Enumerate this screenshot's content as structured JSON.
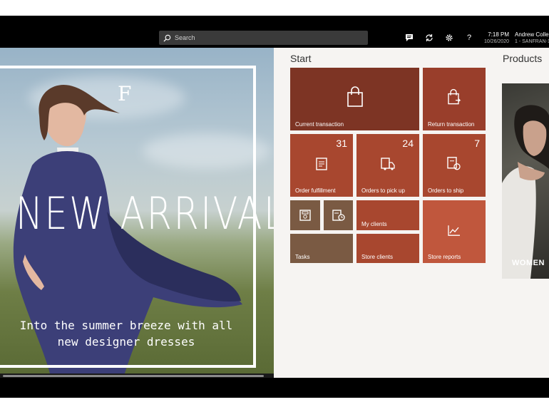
{
  "search": {
    "placeholder": "Search"
  },
  "topbar": {
    "time": "7:18 PM",
    "date": "10/26/2020",
    "user_name": "Andrew Colle",
    "store": "1 - SANFRAN-1"
  },
  "hero": {
    "title": "NEW ARRIVAL",
    "subtitle": "Into the summer breeze with all new designer dresses"
  },
  "start": {
    "title": "Start",
    "tiles": [
      {
        "label": "Current transaction"
      },
      {
        "label": "Return transaction"
      },
      {
        "label": "Order fulfillment",
        "count": "31"
      },
      {
        "label": "Orders to pick up",
        "count": "24"
      },
      {
        "label": "Orders to ship",
        "count": "7"
      },
      {
        "label": "My clients"
      },
      {
        "label": "Tasks"
      },
      {
        "label": "Store clients"
      },
      {
        "label": "Store reports"
      }
    ]
  },
  "products": {
    "title": "Products",
    "items": [
      {
        "label": "WOMEN"
      }
    ]
  },
  "colors": {
    "tile_dark": "#7d3424",
    "tile_mid": "#a8472f",
    "tile_light": "#c0573d",
    "tile_brown": "#7a5a43",
    "panel_bg": "#f6f4f2"
  }
}
